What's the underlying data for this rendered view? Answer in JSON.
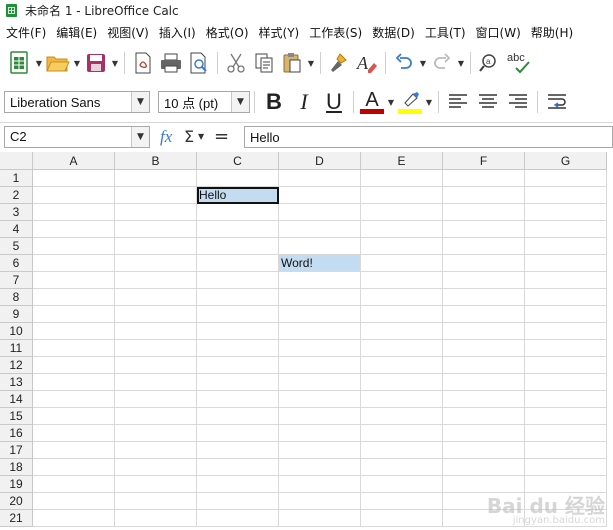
{
  "window": {
    "title": "未命名 1 - LibreOffice Calc"
  },
  "menu": [
    "文件(F)",
    "编辑(E)",
    "视图(V)",
    "插入(I)",
    "格式(O)",
    "样式(Y)",
    "工作表(S)",
    "数据(D)",
    "工具(T)",
    "窗口(W)",
    "帮助(H)"
  ],
  "toolbar": {
    "font_name": "Liberation Sans",
    "font_size": "10 点 (pt)",
    "bold": "B",
    "italic": "I",
    "underline": "U",
    "font_color_glyph": "A",
    "spellcheck_glyph": "abc"
  },
  "colors": {
    "accent": "#3a7bd5",
    "font_color": "#c00000",
    "highlight": "#ffff00",
    "selection": "#c3dcf2"
  },
  "formula_bar": {
    "name_box": "C2",
    "fx": "fx",
    "sigma": "Σ",
    "equals": "=",
    "content": "Hello"
  },
  "sheet": {
    "columns": [
      "A",
      "B",
      "C",
      "D",
      "E",
      "F",
      "G"
    ],
    "rows": [
      "1",
      "2",
      "3",
      "4",
      "5",
      "6",
      "7",
      "8",
      "9",
      "10",
      "11",
      "12",
      "13",
      "14",
      "15",
      "16",
      "17",
      "18",
      "19",
      "20",
      "21"
    ],
    "cells": [
      {
        "ref": "C2",
        "value": "Hello"
      },
      {
        "ref": "D6",
        "value": "Word!"
      }
    ],
    "active_cell": "C2"
  },
  "watermark": {
    "text": "Bai du 经验",
    "sub": "jingyan.baidu.com"
  }
}
